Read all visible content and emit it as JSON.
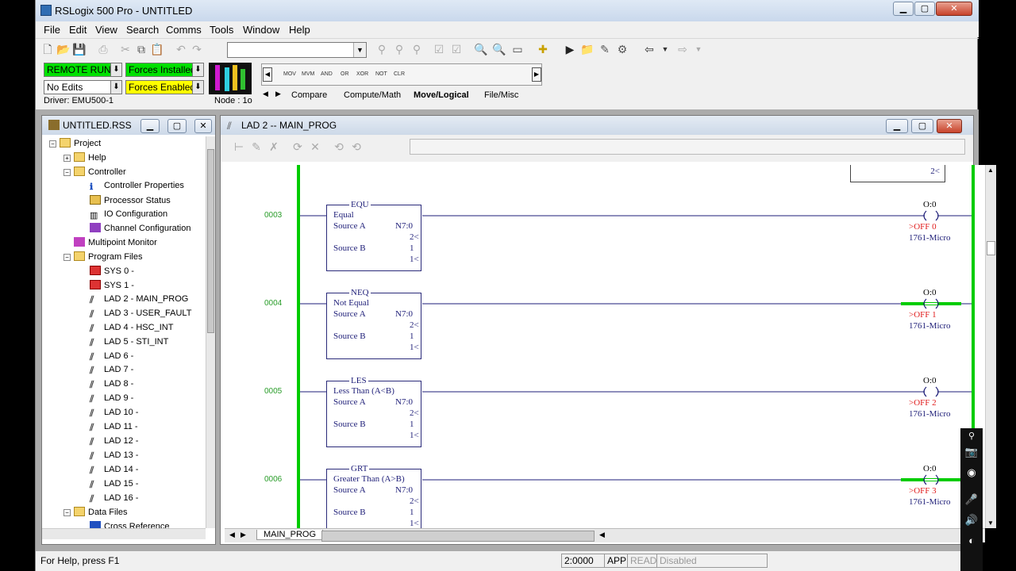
{
  "app": {
    "title": "RSLogix 500 Pro - UNTITLED",
    "window_controls": {
      "minimize": "▁",
      "maximize": "▢",
      "close": "✕"
    }
  },
  "menu": [
    "File",
    "Edit",
    "View",
    "Search",
    "Comms",
    "Tools",
    "Window",
    "Help"
  ],
  "status_panel": {
    "mode": "REMOTE RUN",
    "edits": "No Edits",
    "forces_installed": "Forces Installed",
    "forces_enabled": "Forces Enabled",
    "driver": "Driver: EMU500-1",
    "node": "Node : 1o",
    "colors": {
      "mode_bg": "#00e000",
      "forces_bg": "#00e000",
      "forces_enabled_bg": "#ffff00"
    }
  },
  "instruction_bar": {
    "items": [
      "MOV",
      "MVM",
      "AND",
      "OR",
      "XOR",
      "NOT",
      "CLR"
    ],
    "tabs": [
      "Compare",
      "Compute/Math",
      "Move/Logical",
      "File/Misc"
    ],
    "active_tab": "Move/Logical"
  },
  "project_panel": {
    "title": "UNTITLED.RSS",
    "items": [
      {
        "label": "Project",
        "icon": "folder-icon"
      },
      {
        "label": "Help",
        "icon": "folder-icon"
      },
      {
        "label": "Controller",
        "icon": "folder-icon"
      },
      {
        "label": "Controller Properties",
        "icon": "info-icon"
      },
      {
        "label": "Processor Status",
        "icon": "processor-icon"
      },
      {
        "label": "IO Configuration",
        "icon": "io-icon"
      },
      {
        "label": "Channel Configuration",
        "icon": "channel-icon"
      },
      {
        "label": "Multipoint Monitor",
        "icon": "monitor-icon"
      },
      {
        "label": "Program Files",
        "icon": "folder-icon"
      },
      {
        "label": "SYS 0 -",
        "icon": "sys-file-icon"
      },
      {
        "label": "SYS 1 -",
        "icon": "sys-file-icon"
      },
      {
        "label": "LAD 2 - MAIN_PROG",
        "icon": "ladder-file-icon"
      },
      {
        "label": "LAD 3 - USER_FAULT",
        "icon": "ladder-file-icon"
      },
      {
        "label": "LAD 4 - HSC_INT",
        "icon": "ladder-file-icon"
      },
      {
        "label": "LAD 5 - STI_INT",
        "icon": "ladder-file-icon"
      },
      {
        "label": "LAD 6 -",
        "icon": "ladder-file-icon"
      },
      {
        "label": "LAD 7 -",
        "icon": "ladder-file-icon"
      },
      {
        "label": "LAD 8 -",
        "icon": "ladder-file-icon"
      },
      {
        "label": "LAD 9 -",
        "icon": "ladder-file-icon"
      },
      {
        "label": "LAD 10 -",
        "icon": "ladder-file-icon"
      },
      {
        "label": "LAD 11 -",
        "icon": "ladder-file-icon"
      },
      {
        "label": "LAD 12 -",
        "icon": "ladder-file-icon"
      },
      {
        "label": "LAD 13 -",
        "icon": "ladder-file-icon"
      },
      {
        "label": "LAD 14 -",
        "icon": "ladder-file-icon"
      },
      {
        "label": "LAD 15 -",
        "icon": "ladder-file-icon"
      },
      {
        "label": "LAD 16 -",
        "icon": "ladder-file-icon"
      },
      {
        "label": "Data Files",
        "icon": "folder-icon"
      },
      {
        "label": "Cross Reference",
        "icon": "cross-ref-icon"
      }
    ]
  },
  "ladder_window": {
    "title": "LAD 2 -- MAIN_PROG",
    "top_partial_value": "2<",
    "tab": "MAIN_PROG",
    "rungs": [
      {
        "number": "0003",
        "instr": "EQU",
        "desc": "Equal",
        "src_a_label": "Source A",
        "src_a": "N7:0",
        "src_a_val": "2<",
        "src_b_label": "Source B",
        "src_b": "1",
        "src_b_val": "1<",
        "coil_addr": "O:0",
        "coil_bit": ">OFF 0",
        "coil_desc": "1761-Micro",
        "energized": false
      },
      {
        "number": "0004",
        "instr": "NEQ",
        "desc": "Not Equal",
        "src_a_label": "Source A",
        "src_a": "N7:0",
        "src_a_val": "2<",
        "src_b_label": "Source B",
        "src_b": "1",
        "src_b_val": "1<",
        "coil_addr": "O:0",
        "coil_bit": ">OFF 1",
        "coil_desc": "1761-Micro",
        "energized": true
      },
      {
        "number": "0005",
        "instr": "LES",
        "desc": "Less Than (A<B)",
        "src_a_label": "Source A",
        "src_a": "N7:0",
        "src_a_val": "2<",
        "src_b_label": "Source B",
        "src_b": "1",
        "src_b_val": "1<",
        "coil_addr": "O:0",
        "coil_bit": ">OFF 2",
        "coil_desc": "1761-Micro",
        "energized": false
      },
      {
        "number": "0006",
        "instr": "GRT",
        "desc": "Greater Than (A>B)",
        "src_a_label": "Source A",
        "src_a": "N7:0",
        "src_a_val": "2<",
        "src_b_label": "Source B",
        "src_b": "1",
        "src_b_val": "1<",
        "coil_addr": "O:0",
        "coil_bit": ">OFF 3",
        "coil_desc": "1761-Micro",
        "energized": true
      }
    ],
    "colors": {
      "rail": "#00cc00",
      "energized": "#00cc00",
      "box": "#1e1e78"
    }
  },
  "statusbar": {
    "help": "For Help, press F1",
    "position": "2:0000",
    "mode": "APP",
    "read": "READ",
    "state": "Disabled"
  }
}
